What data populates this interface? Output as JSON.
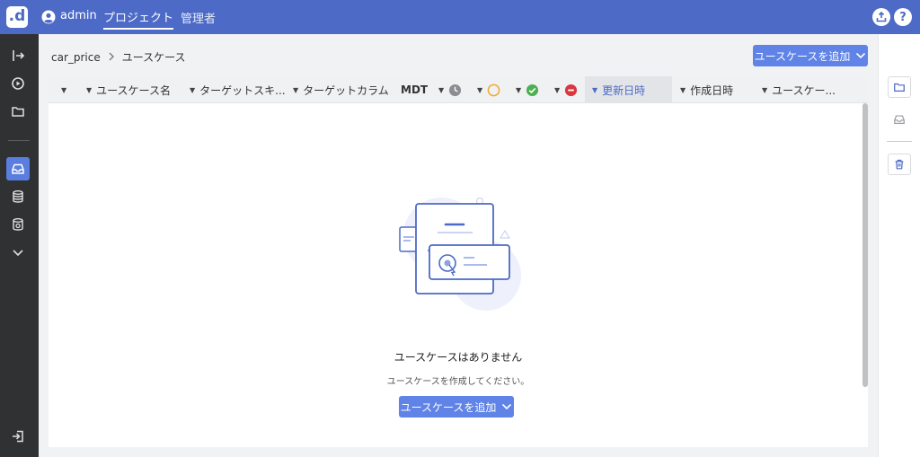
{
  "header": {
    "logo_letter": ".d",
    "user_name": "admin",
    "nav_project": "プロジェクト",
    "nav_admin": "管理者",
    "help_label": "?"
  },
  "breadcrumb": {
    "project": "car_price",
    "current": "ユースケース"
  },
  "actions": {
    "add_usecase": "ユースケースを追加"
  },
  "table": {
    "columns": [
      {
        "label": ""
      },
      {
        "label": "ユースケース名"
      },
      {
        "label": "ターゲットスキ..."
      },
      {
        "label": "ターゲットカラム"
      },
      {
        "label": "MDT"
      },
      {
        "label": "",
        "icon": "clock-icon"
      },
      {
        "label": "",
        "icon": "pending-circle-icon"
      },
      {
        "label": "",
        "icon": "check-circle-icon"
      },
      {
        "label": "",
        "icon": "error-circle-icon"
      },
      {
        "label": "更新日時"
      },
      {
        "label": "作成日時"
      },
      {
        "label": "ユースケー..."
      }
    ]
  },
  "empty_state": {
    "title": "ユースケースはありません",
    "subtitle": "ユースケースを作成してください。",
    "button": "ユースケースを追加"
  },
  "colors": {
    "header_bg": "#4c6ac6",
    "sidebar_bg": "#2f3133",
    "accent": "#5f83e6",
    "pending": "#f0a830",
    "success": "#4caf50",
    "error": "#d9363e"
  },
  "icons": {
    "sidebar": [
      "arrow-right-bar-icon",
      "play-circle-icon",
      "folder-icon",
      "inbox-icon",
      "database-icon",
      "database-settings-icon",
      "chevron-down-icon",
      "logout-icon"
    ],
    "right": [
      "folder-icon",
      "inbox-icon",
      "trash-icon"
    ]
  }
}
